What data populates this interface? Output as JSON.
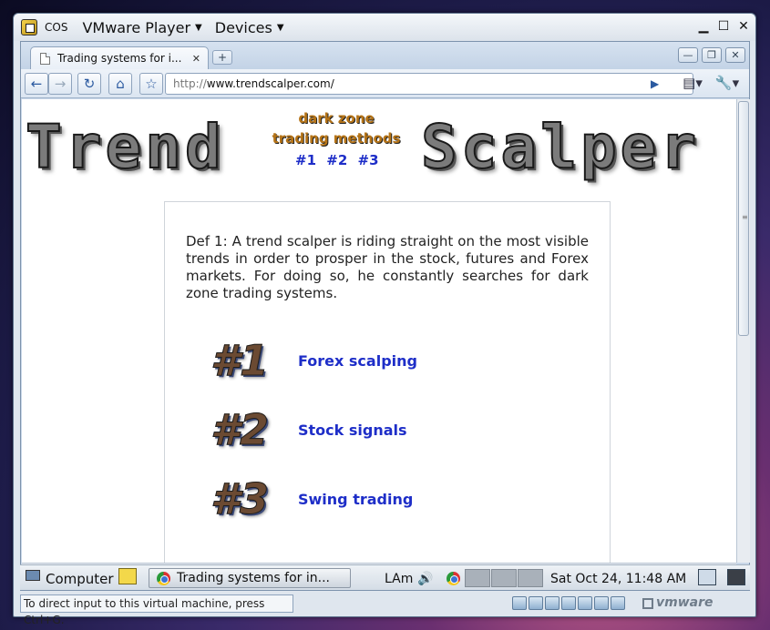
{
  "vmware": {
    "os_label": "COS",
    "menus": [
      {
        "label": "VMware Player"
      },
      {
        "label": "Devices"
      }
    ],
    "status_hint": "To direct input to this virtual machine, press Ctrl+G.",
    "brand": "vmware"
  },
  "browser": {
    "tab_title": "Trading systems for i...",
    "url_scheme": "http://",
    "url_host": "www.trendscalper.com/"
  },
  "page": {
    "logo_left": "Trend",
    "logo_right": "Scalper",
    "tagline_1": "dark zone",
    "tagline_2": "trading methods",
    "header_links": [
      "#1",
      "#2",
      "#3"
    ],
    "definition": "Def 1: A trend scalper is riding straight on the most visible trends in order to prosper in the stock, futures and Forex markets. For doing so, he constantly searches for dark zone trading systems.",
    "items": [
      {
        "number": "#1",
        "label": "Forex scalping"
      },
      {
        "number": "#2",
        "label": "Stock signals"
      },
      {
        "number": "#3",
        "label": "Swing trading"
      }
    ]
  },
  "taskbar": {
    "computer_label": "Computer",
    "task_label": "Trading systems for in...",
    "keyboard_label": "LAm",
    "clock": "Sat Oct 24, 11:48 AM"
  }
}
